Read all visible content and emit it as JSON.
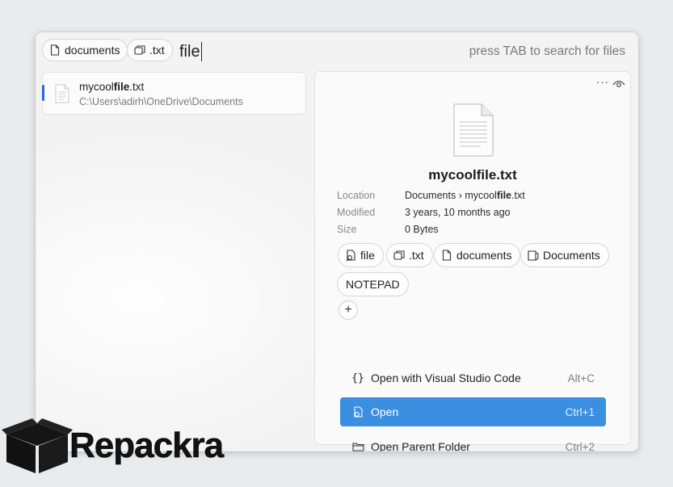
{
  "search": {
    "chips": [
      {
        "label": "documents",
        "icon": "file-icon"
      },
      {
        "label": ".txt",
        "icon": "copy-icon"
      }
    ],
    "query": "file",
    "hint": "press TAB to search for files"
  },
  "results": [
    {
      "name_prefix": "mycool",
      "name_match": "file",
      "name_suffix": ".txt",
      "path": "C:\\Users\\adirh\\OneDrive\\Documents"
    }
  ],
  "preview": {
    "more_label": "···",
    "title": "mycoolfile.txt",
    "meta": [
      {
        "key": "Location",
        "value_prefix": "Documents › mycool",
        "value_match": "file",
        "value_suffix": ".txt"
      },
      {
        "key": "Modified",
        "value": "3 years, 10 months ago"
      },
      {
        "key": "Size",
        "value": "0 Bytes"
      }
    ],
    "tags": [
      {
        "label": "file",
        "icon": "file-search-icon"
      },
      {
        "label": ".txt",
        "icon": "copy-icon"
      },
      {
        "label": "documents",
        "icon": "file-icon"
      },
      {
        "label": "Documents",
        "icon": "folder-doc-icon"
      },
      {
        "label": "NOTEPAD",
        "icon": ""
      }
    ],
    "add_label": "+",
    "actions": [
      {
        "icon": "{}",
        "label": "Open with Visual Studio Code",
        "shortcut": "Alt+C",
        "active": false
      },
      {
        "icon": "open-icon",
        "label": "Open",
        "shortcut": "Ctrl+1",
        "active": true
      },
      {
        "icon": "folder-icon",
        "label": "Open Parent Folder",
        "shortcut": "Ctrl+2",
        "active": false
      }
    ]
  },
  "watermark": {
    "text": "Repackra"
  },
  "colors": {
    "accent": "#3a8fe0",
    "selection_bar": "#1f6fd1"
  }
}
